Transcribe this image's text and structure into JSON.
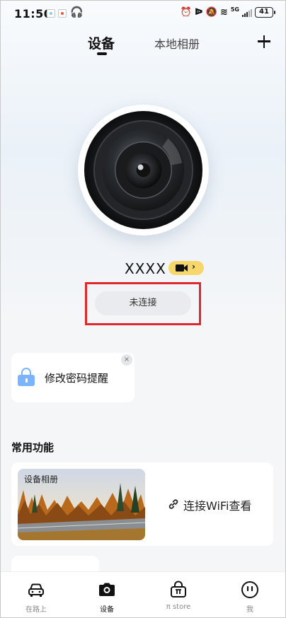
{
  "status_bar": {
    "time": "11:50",
    "battery": "41",
    "network": "5G"
  },
  "header": {
    "tab_device": "设备",
    "tab_album": "本地相册",
    "add_icon": "plus-icon"
  },
  "device": {
    "name": "XXXX",
    "connection_status": "未连接",
    "record_icon": "video-camera-icon"
  },
  "password_card": {
    "label": "修改密码提醒",
    "close_symbol": "×"
  },
  "common_functions": {
    "title": "常用功能",
    "album_label": "设备相册",
    "wifi_label": "连接WiFi查看"
  },
  "bottom_nav": [
    {
      "label": "在路上",
      "icon": "car-icon"
    },
    {
      "label": "设备",
      "icon": "camera-icon"
    },
    {
      "label": "π store",
      "icon": "store-bag-icon"
    },
    {
      "label": "我",
      "icon": "profile-face-icon"
    }
  ],
  "colors": {
    "accent_badge": "#f7d76a",
    "lock_blue": "#7ab4ff",
    "highlight_red": "#e0272b"
  }
}
